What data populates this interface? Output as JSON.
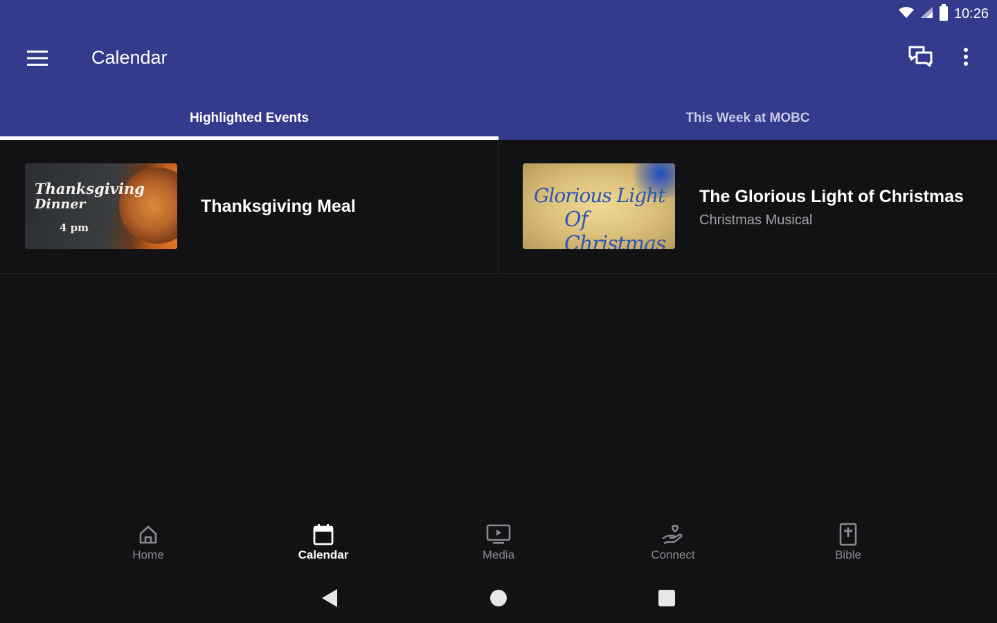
{
  "status_bar": {
    "time": "10:26"
  },
  "toolbar": {
    "title": "Calendar",
    "menu_icon": "hamburger-menu-icon",
    "chat_icon": "chat-icon",
    "more_icon": "more-vert-icon"
  },
  "tabs": [
    {
      "label": "Highlighted Events",
      "active": true
    },
    {
      "label": "This Week at MOBC",
      "active": false
    }
  ],
  "events": [
    {
      "title": "Thanksgiving Meal",
      "subtitle": "",
      "thumbnail": {
        "line1": "Thanksgiving",
        "line2": "Dinner",
        "line3": "4 pm"
      }
    },
    {
      "title": "The Glorious Light of Christmas",
      "subtitle": "Christmas Musical",
      "thumbnail": {
        "line1": "Glorious Light",
        "line2": "Of Christmas"
      }
    }
  ],
  "bottom_nav": [
    {
      "label": "Home",
      "icon": "home-icon",
      "active": false
    },
    {
      "label": "Calendar",
      "icon": "calendar-icon",
      "active": true
    },
    {
      "label": "Media",
      "icon": "media-icon",
      "active": false
    },
    {
      "label": "Connect",
      "icon": "connect-icon",
      "active": false
    },
    {
      "label": "Bible",
      "icon": "bible-icon",
      "active": false
    }
  ],
  "colors": {
    "app_bar": "#343a8c",
    "background": "#121214",
    "active_text": "#ffffff",
    "inactive_text": "#8a8a90"
  }
}
